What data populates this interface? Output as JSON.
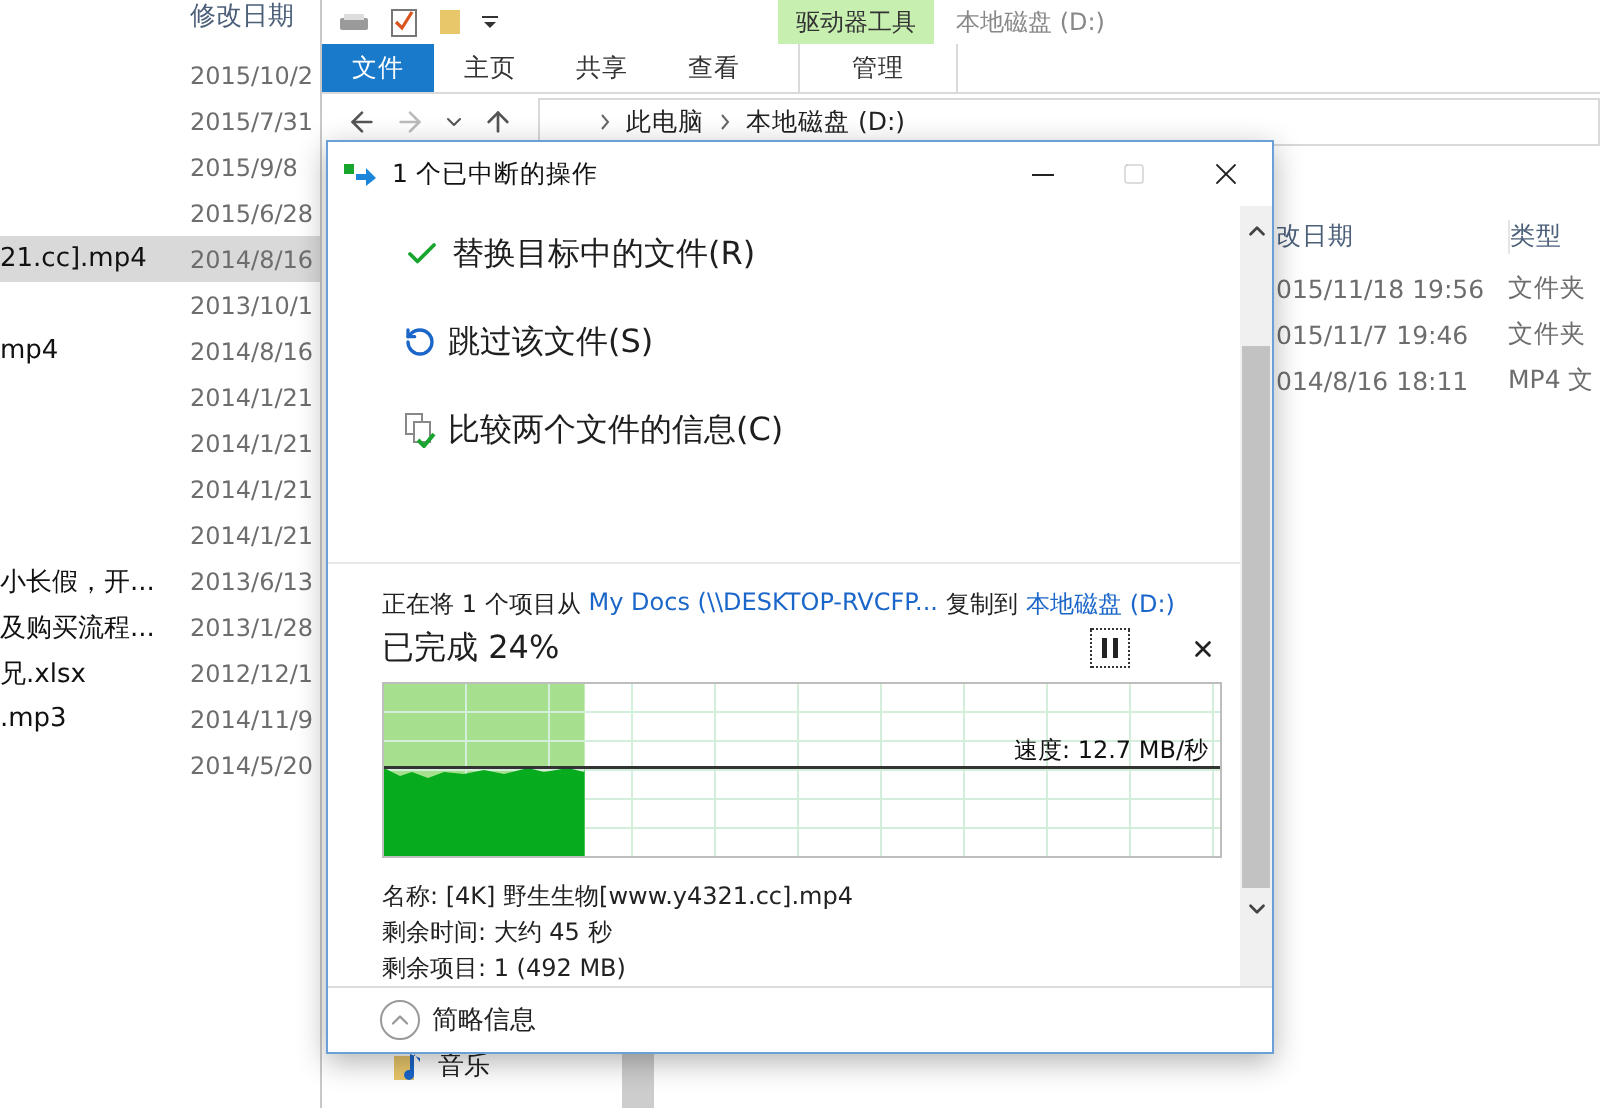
{
  "back_window": {
    "column_header": "修改日期",
    "rows": [
      {
        "date": "2015/10/2",
        "selected": false
      },
      {
        "date": "2015/7/31",
        "selected": false
      },
      {
        "date": "2015/9/8",
        "selected": false
      },
      {
        "date": "2015/6/28",
        "selected": false
      },
      {
        "name": "21.cc].mp4",
        "date": "2014/8/16",
        "selected": true
      },
      {
        "date": "2013/10/1",
        "selected": false
      },
      {
        "name": "mp4",
        "date": "2014/8/16",
        "selected": false
      },
      {
        "date": "2014/1/21",
        "selected": false
      },
      {
        "date": "2014/1/21",
        "selected": false
      },
      {
        "date": "2014/1/21",
        "selected": false
      },
      {
        "date": "2014/1/21",
        "selected": false
      },
      {
        "name": "小长假，开...",
        "date": "2013/6/13",
        "selected": false
      },
      {
        "name": "及购买流程...",
        "date": "2013/1/28",
        "selected": false
      },
      {
        "name": "兄.xlsx",
        "date": "2012/12/1",
        "selected": false
      },
      {
        "name": ".mp3",
        "date": "2014/11/9",
        "selected": false
      },
      {
        "date": "2014/5/20",
        "selected": false
      }
    ]
  },
  "explorer": {
    "title": "本地磁盘 (D:)",
    "context_group": "驱动器工具",
    "tabs": [
      {
        "label": "文件",
        "selected": true
      },
      {
        "label": "主页",
        "selected": false
      },
      {
        "label": "共享",
        "selected": false
      },
      {
        "label": "查看",
        "selected": false
      },
      {
        "label": "管理",
        "selected": false
      }
    ],
    "breadcrumb": [
      "此电脑",
      "本地磁盘 (D:)"
    ],
    "columns": [
      "改日期",
      "类型"
    ],
    "rows": [
      {
        "date": "015/11/18 19:56",
        "type": "文件夹"
      },
      {
        "date": "015/11/7 19:46",
        "type": "文件夹"
      },
      {
        "date": "014/8/16 18:11",
        "type": "MP4 文"
      }
    ],
    "nav_items": [
      "音乐"
    ]
  },
  "dialog": {
    "title": "1 个已中断的操作",
    "options": [
      {
        "kind": "replace",
        "label": "替换目标中的文件(R)"
      },
      {
        "kind": "skip",
        "label": "跳过该文件(S)"
      },
      {
        "kind": "compare",
        "label": "比较两个文件的信息(C)"
      }
    ],
    "copy_status": {
      "prefix": "正在将 1 个项目从",
      "source": "My Docs (\\\\DESKTOP-RVCFP...",
      "middle": "复制到",
      "target": "本地磁盘 (D:)"
    },
    "percent": "已完成 24%",
    "level": 0.24,
    "speed": "速度: 12.7 MB/秒",
    "details": [
      "名称: [4K] 野生生物[www.y4321.cc].mp4",
      "剩余时间: 大约 45 秒",
      "剩余项目: 1 (492 MB)"
    ],
    "less_details": "简略信息"
  }
}
